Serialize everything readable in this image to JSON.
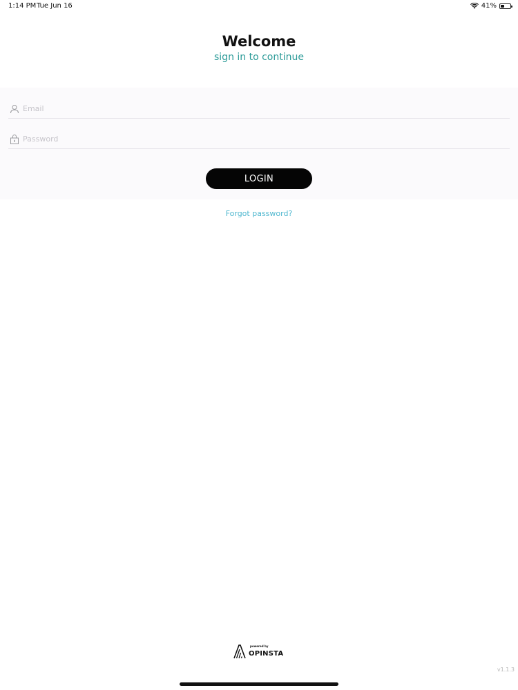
{
  "status_bar": {
    "time": "1:14 PM",
    "date": "Tue Jun 16",
    "battery_text": "41%",
    "battery_level": 0.41
  },
  "header": {
    "title": "Welcome",
    "subtitle": "sign in to continue"
  },
  "form": {
    "email": {
      "placeholder": "Email",
      "value": "",
      "icon": "person-icon"
    },
    "password": {
      "placeholder": "Password",
      "value": "",
      "icon": "lock-icon"
    },
    "login_label": "LOGIN",
    "forgot_label": "Forgot password?"
  },
  "footer": {
    "powered_by": "powered by",
    "brand_name": "OPINSTA",
    "version": "v1.1.3"
  },
  "colors": {
    "accent_teal": "#2a9a97",
    "link_blue": "#4fb7cf",
    "button_bg": "#050505",
    "panel_bg": "#fbfafc"
  }
}
